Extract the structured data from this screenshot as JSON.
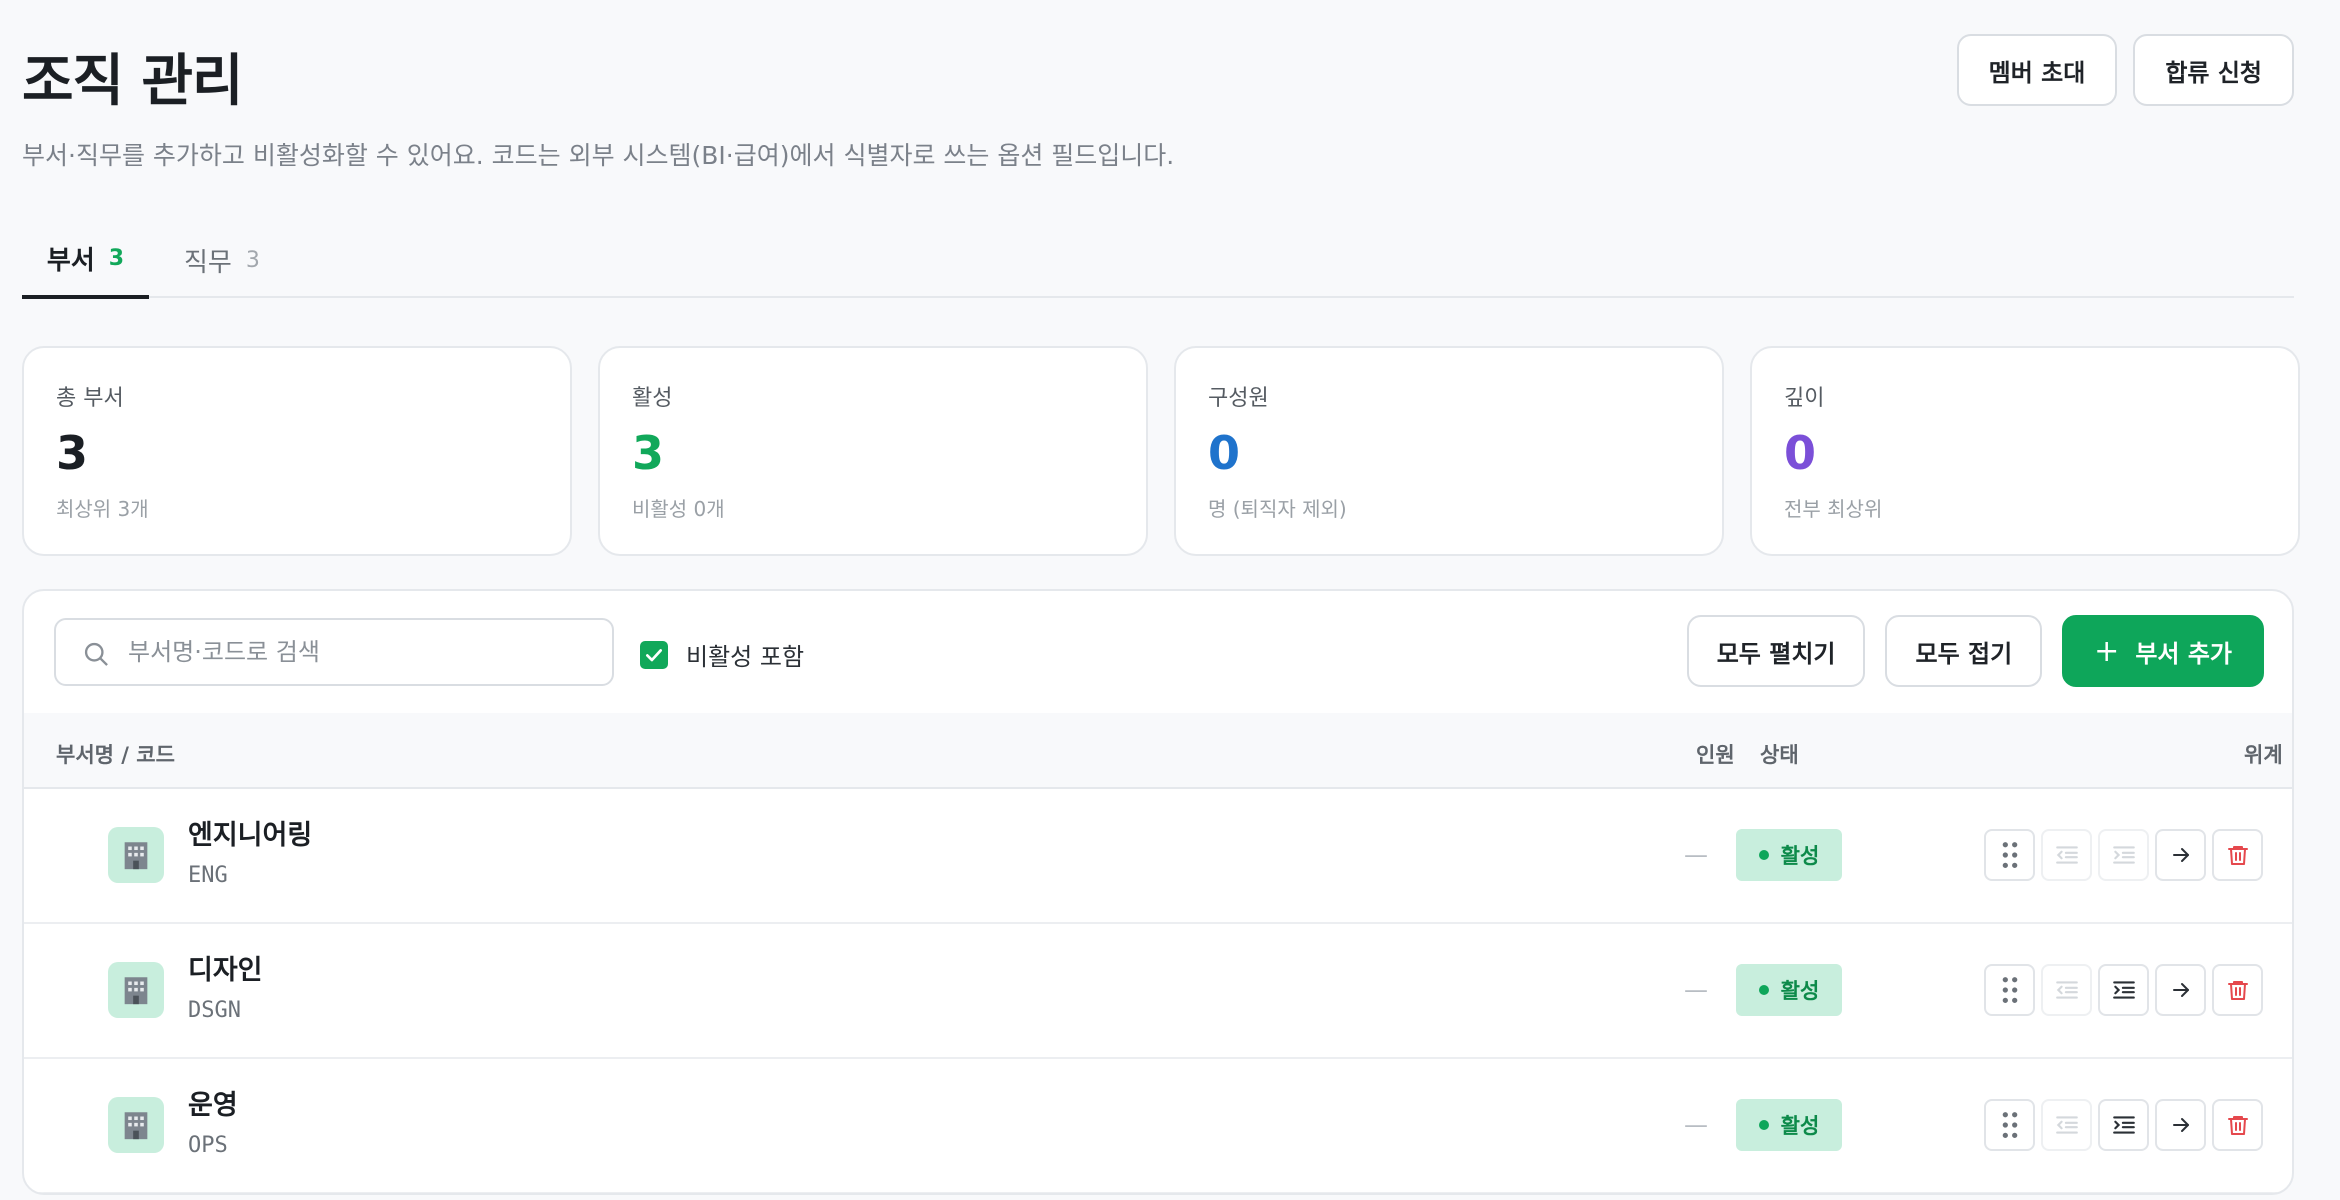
{
  "header": {
    "title": "조직 관리",
    "subtitle": "부서·직무를 추가하고 비활성화할 수 있어요. 코드는 외부 시스템(BI·급여)에서 식별자로 쓰는 옵션 필드입니다.",
    "invite_label": "멤버 초대",
    "join_label": "합류 신청"
  },
  "tabs": [
    {
      "label": "부서",
      "count": "3"
    },
    {
      "label": "직무",
      "count": "3"
    }
  ],
  "stats": [
    {
      "label": "총 부서",
      "value": "3",
      "note": "최상위 3개",
      "color": "#1b1f24"
    },
    {
      "label": "활성",
      "value": "3",
      "note": "비활성 0개",
      "color": "#11a85a"
    },
    {
      "label": "구성원",
      "value": "0",
      "note": "명 (퇴직자 제외)",
      "color": "#1f73cc"
    },
    {
      "label": "깊이",
      "value": "0",
      "note": "전부 최상위",
      "color": "#7b4fd8"
    }
  ],
  "toolbar": {
    "search_placeholder": "부서명·코드로 검색",
    "include_inactive_label": "비활성 포함",
    "include_inactive_checked": true,
    "expand_all_label": "모두 펼치기",
    "collapse_all_label": "모두 접기",
    "add_label": "부서 추가"
  },
  "table": {
    "columns": {
      "name": "부서명 / 코드",
      "members": "인원",
      "status": "상태",
      "hierarchy": "위계"
    },
    "rows": [
      {
        "name": "엔지니어링",
        "code": "ENG",
        "members": "—",
        "status": "활성",
        "outdent_enabled": false,
        "indent_enabled": false
      },
      {
        "name": "디자인",
        "code": "DSGN",
        "members": "—",
        "status": "활성",
        "outdent_enabled": false,
        "indent_enabled": true
      },
      {
        "name": "운영",
        "code": "OPS",
        "members": "—",
        "status": "활성",
        "outdent_enabled": false,
        "indent_enabled": true
      }
    ]
  },
  "colors": {
    "accent": "#0ea65a",
    "badge_bg": "#c8eedd",
    "danger": "#e5484d"
  },
  "icons": {
    "search": "search-icon",
    "checkbox": "check-icon",
    "add": "plus-icon",
    "department": "building-icon",
    "drag": "drag-handle-icon",
    "outdent": "outdent-icon",
    "indent": "indent-icon",
    "move": "arrow-right-icon",
    "delete": "trash-icon"
  }
}
